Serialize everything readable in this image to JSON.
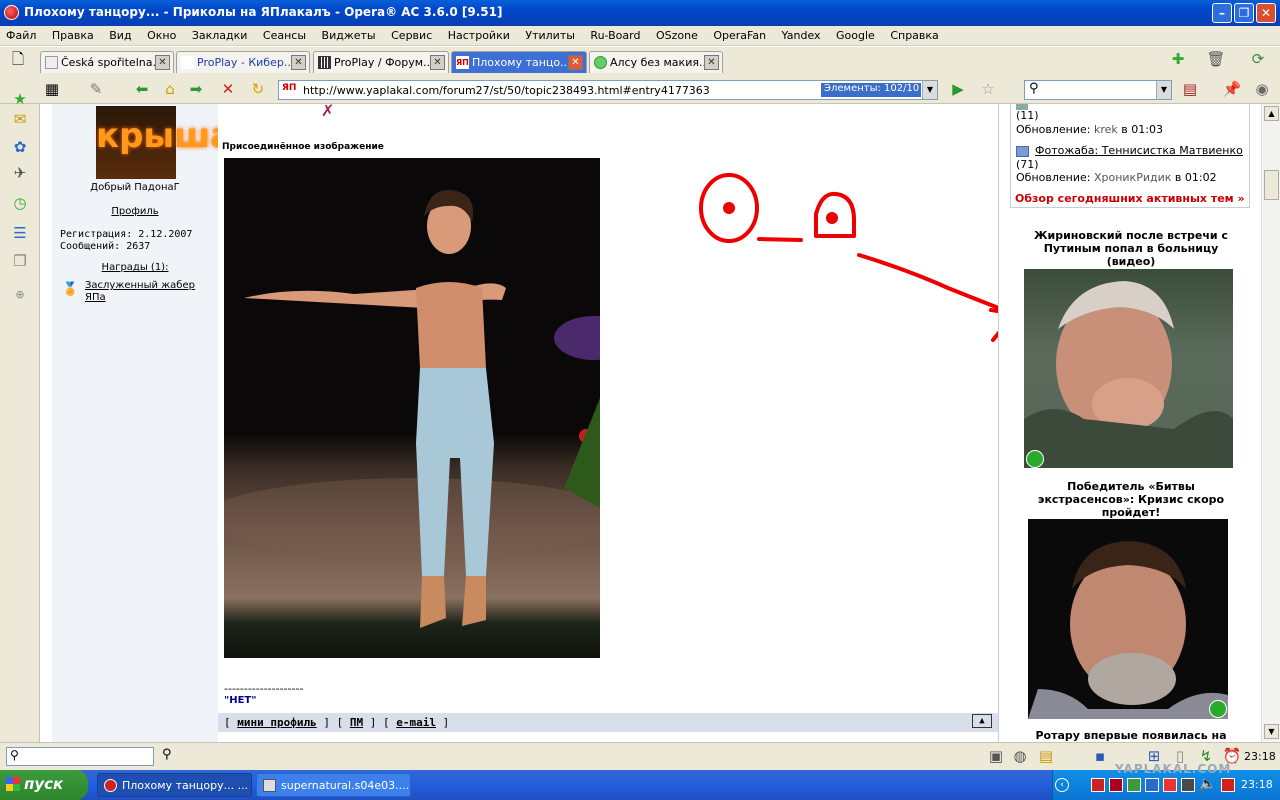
{
  "window": {
    "title": "Плохому танцору... - Приколы на ЯПлакалъ - Opera® AC 3.6.0 [9.51]"
  },
  "menu": [
    "Файл",
    "Правка",
    "Вид",
    "Окно",
    "Закладки",
    "Сеансы",
    "Виджеты",
    "Сервис",
    "Настройки",
    "Утилиты",
    "Ru-Board",
    "OSzone",
    "OperaFan",
    "Yandex",
    "Google",
    "Справка"
  ],
  "tabs": [
    {
      "label": "Česká spořitelna..."
    },
    {
      "label": "ProPlay - Кибер..."
    },
    {
      "label": "ProPlay / Форум..."
    },
    {
      "label": "Плохому танцо..."
    },
    {
      "label": "Алсу без макия..."
    }
  ],
  "address": {
    "url": "http://www.yaplakal.com/forum27/st/50/topic238493.html#entry4177363",
    "elements": "Элементы:  102/10",
    "site_badge": "ЯП"
  },
  "user": {
    "avatar_text": "крыша",
    "rank": "Добрый ПадонаГ",
    "profile_link": "Профиль",
    "registered": "Регистрация: 2.12.2007",
    "messages": "Сообщений: 2637",
    "awards_link": "Награды (1):",
    "award": "Заслуженный жабер ЯПа"
  },
  "post": {
    "attachment_label": "Присоединённое изображение",
    "signature_line": "--------------------",
    "signature": "\"НЕТ\"",
    "footer_links": [
      "мини профиль",
      "ПМ",
      "e-mail"
    ]
  },
  "sidebar": {
    "topic1_count": "(11)",
    "topic1_update_prefix": "Обновление:",
    "topic1_user": "krek",
    "topic1_time": "в 01:03",
    "topic2_title": "Фотожаба: Теннисистка Матвиенко",
    "topic2_count": "(71)",
    "topic2_update_prefix": "Обновление:",
    "topic2_user": "ХроникРидик",
    "topic2_time": "в 01:02",
    "overview_link": "Обзор сегодняшних активных тем »",
    "news": [
      {
        "title": "Жириновский после встречи с Путиным попал в больницу (видео)"
      },
      {
        "title": "Победитель «Битвы экстрасенсов»: Кризис скоро пройдет!"
      },
      {
        "title": "Ротару впервые появилась на"
      }
    ]
  },
  "status": {
    "clock": "23:18"
  },
  "taskbar": {
    "start": "пуск",
    "items": [
      "Плохому танцору... ...",
      "supernatural.s04e03...."
    ],
    "clock": "23:18",
    "watermark": "YAPLAKAL.COM"
  },
  "colors": {
    "link_red": "#cc0000",
    "ink_red": "#ee0000",
    "xp_blue": "#245ddb"
  }
}
